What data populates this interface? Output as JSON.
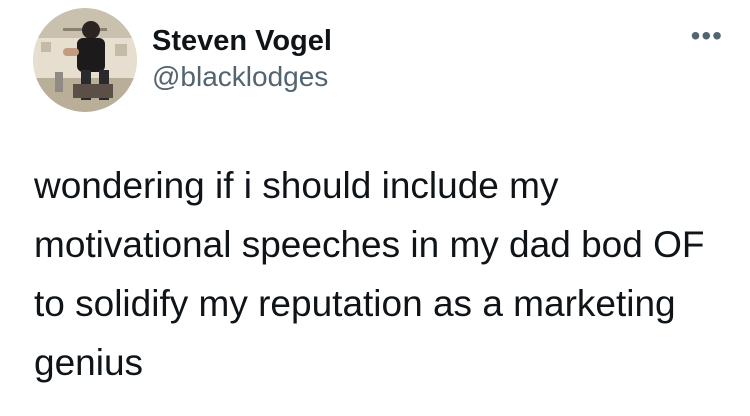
{
  "tweet": {
    "display_name": "Steven Vogel",
    "handle": "@blacklodges",
    "more_label": "•••",
    "text": "wondering if i should include my motivational speeches in my dad bod OF to solidify my reputation as a marketing genius"
  },
  "icons": {
    "more": "more-options-icon",
    "avatar": "profile-photo"
  },
  "colors": {
    "primary_text": "#0f1419",
    "secondary_text": "#536471",
    "background": "#ffffff"
  }
}
